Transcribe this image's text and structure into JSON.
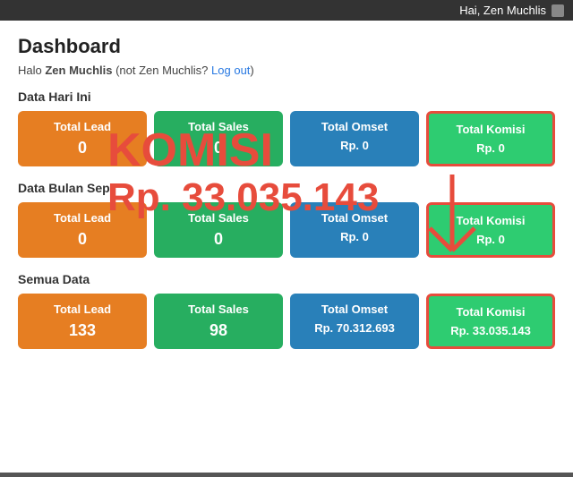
{
  "topbar": {
    "user_text": "Hai, Zen Muchlis"
  },
  "header": {
    "title": "Dashboard",
    "greeting_prefix": "Halo ",
    "greeting_user": "Zen Muchlis",
    "greeting_not": " (not Zen Muchlis?",
    "logout_text": "Log out",
    "greeting_suffix": ")"
  },
  "sections": {
    "today": {
      "title": "Data Hari Ini",
      "cards": [
        {
          "label": "Total Lead",
          "value": "0",
          "color": "orange"
        },
        {
          "label": "Total Sales",
          "value": "0",
          "color": "green"
        },
        {
          "label": "Total Omset",
          "value": "Rp. 0",
          "color": "blue"
        },
        {
          "label": "Total Komisi",
          "value": "Rp. 0",
          "color": "green-light"
        }
      ]
    },
    "month": {
      "title": "Data Bulan Sep",
      "cards": [
        {
          "label": "Total Lead",
          "value": "0",
          "color": "orange"
        },
        {
          "label": "Total Sales",
          "value": "0",
          "color": "green"
        },
        {
          "label": "Total Omset",
          "value": "Rp. 0",
          "color": "blue"
        },
        {
          "label": "Total Komisi",
          "value": "Rp. 0",
          "color": "green-light"
        }
      ]
    },
    "all": {
      "title": "Semua Data",
      "cards": [
        {
          "label": "Total Lead",
          "value": "133",
          "color": "orange"
        },
        {
          "label": "Total Sales",
          "value": "98",
          "color": "green"
        },
        {
          "label": "Total Omset",
          "value": "Rp. 70.312.693",
          "color": "blue"
        },
        {
          "label": "Total Komisi",
          "value": "Rp. 33.035.143",
          "color": "green-light"
        }
      ]
    }
  },
  "overlay": {
    "komisi_label": "KOMISI",
    "komisi_value": "Rp. 33.035.143"
  }
}
